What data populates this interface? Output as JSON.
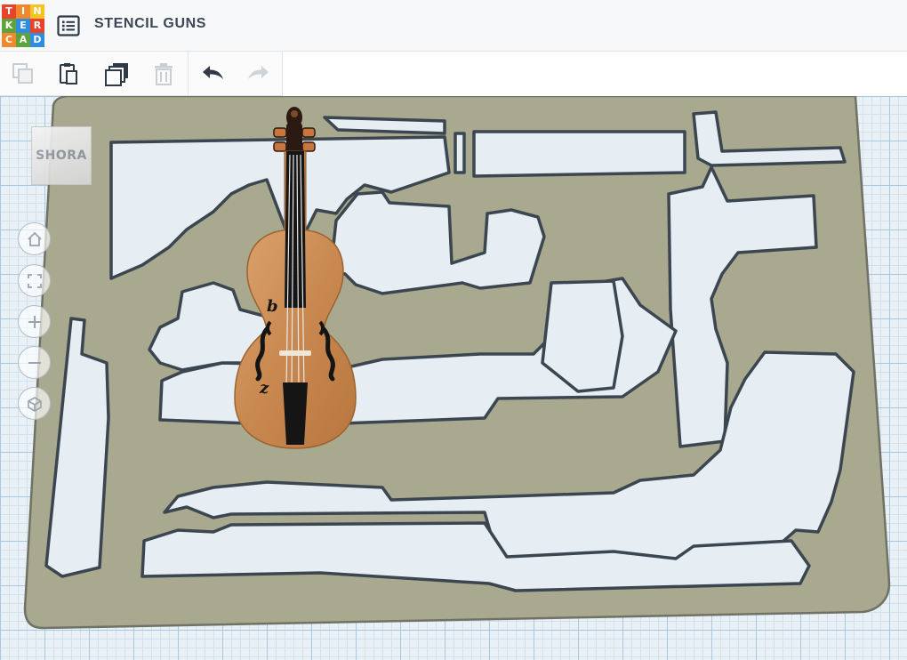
{
  "app": {
    "logo_letters": [
      "T",
      "I",
      "N",
      "K",
      "E",
      "R",
      "C",
      "A",
      "D"
    ],
    "logo_colors": [
      "#e8442c",
      "#f0892d",
      "#f6c324",
      "#5da23a",
      "#2e8de0",
      "#e8442c",
      "#f0892d",
      "#5da23a",
      "#2e8de0"
    ],
    "design_title": "STENCIL GUNS",
    "menu_icon": "list-icon"
  },
  "toolbar": {
    "copy": {
      "icon": "copy-icon",
      "enabled": false
    },
    "paste": {
      "icon": "paste-icon",
      "enabled": true
    },
    "duplicate": {
      "icon": "duplicate-icon",
      "enabled": true
    },
    "delete": {
      "icon": "trash-icon",
      "enabled": false
    },
    "undo": {
      "icon": "undo-arrow-icon",
      "enabled": true
    },
    "redo": {
      "icon": "redo-arrow-icon",
      "enabled": false
    }
  },
  "viewcube": {
    "face_label": "SHORA"
  },
  "nav_controls": [
    "home-icon",
    "fit-view-icon",
    "zoom-in-icon",
    "zoom-out-icon",
    "ortho-view-icon"
  ],
  "scene": {
    "stencil_color": "#a9a98f",
    "grid_color": "#a8c8de",
    "violin_labels": [
      "b",
      "z"
    ]
  }
}
